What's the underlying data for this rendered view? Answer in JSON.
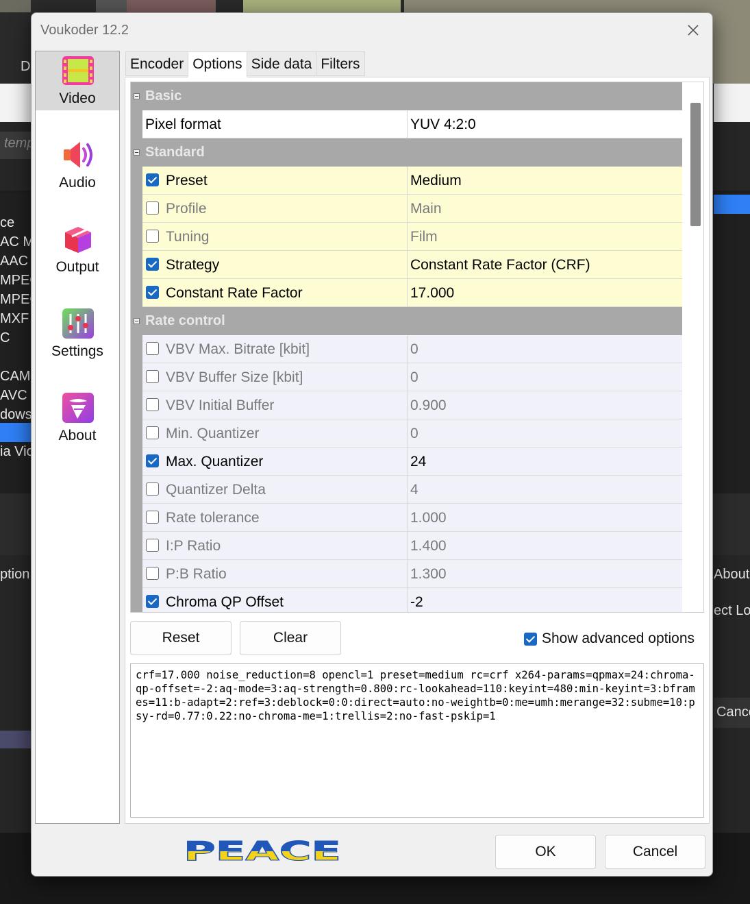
{
  "background": {
    "search_placeholder": "temp",
    "left_letter": "D",
    "list_items": [
      "ce",
      "AC M",
      "AAC",
      "MPEG",
      "MPEG",
      "MXF",
      "C",
      "",
      "CAM",
      "AVC",
      "dows",
      "",
      "ia Vic"
    ],
    "left_options_text": "ption",
    "right_about_text": "About",
    "right_select_text": "ect Lo",
    "right_cancel_text": "Cance"
  },
  "dialog": {
    "title": "Voukoder 12.2",
    "close_glyph": "✕"
  },
  "sidebar": {
    "items": [
      {
        "label": "Video",
        "icon": "film-icon"
      },
      {
        "label": "Audio",
        "icon": "speaker-icon"
      },
      {
        "label": "Output",
        "icon": "box-icon"
      },
      {
        "label": "Settings",
        "icon": "sliders-icon"
      },
      {
        "label": "About",
        "icon": "tornado-icon"
      }
    ]
  },
  "tabs": [
    "Encoder",
    "Options",
    "Side data",
    "Filters"
  ],
  "active_tab": "Options",
  "grid": {
    "categories": {
      "basic": "Basic",
      "standard": "Standard",
      "rate_control": "Rate control"
    },
    "pixel_format": {
      "name": "Pixel format",
      "value": "YUV 4:2:0"
    },
    "standard": [
      {
        "name": "Preset",
        "value": "Medium",
        "checked": true
      },
      {
        "name": "Profile",
        "value": "Main",
        "checked": false
      },
      {
        "name": "Tuning",
        "value": "Film",
        "checked": false
      },
      {
        "name": "Strategy",
        "value": "Constant Rate Factor (CRF)",
        "checked": true
      },
      {
        "name": "Constant Rate Factor",
        "value": "17.000",
        "checked": true
      }
    ],
    "rate_control": [
      {
        "name": "VBV Max. Bitrate [kbit]",
        "value": "0",
        "checked": false
      },
      {
        "name": "VBV Buffer Size [kbit]",
        "value": "0",
        "checked": false
      },
      {
        "name": "VBV Initial Buffer",
        "value": "0.900",
        "checked": false
      },
      {
        "name": "Min. Quantizer",
        "value": "0",
        "checked": false
      },
      {
        "name": "Max. Quantizer",
        "value": "24",
        "checked": true
      },
      {
        "name": "Quantizer Delta",
        "value": "4",
        "checked": false
      },
      {
        "name": "Rate tolerance",
        "value": "1.000",
        "checked": false
      },
      {
        "name": "I:P Ratio",
        "value": "1.400",
        "checked": false
      },
      {
        "name": "P:B Ratio",
        "value": "1.300",
        "checked": false
      },
      {
        "name": "Chroma QP Offset",
        "value": "-2",
        "checked": true
      }
    ]
  },
  "buttons": {
    "reset": "Reset",
    "clear": "Clear",
    "show_advanced": "Show advanced options",
    "show_advanced_checked": true,
    "ok": "OK",
    "cancel": "Cancel"
  },
  "command_line": "crf=17.000 noise_reduction=8 opencl=1 preset=medium rc=crf x264-params=qpmax=24:chroma-qp-offset=-2:aq-mode=3:aq-strength=0.800:rc-lookahead=110:keyint=480:min-keyint=3:bframes=11:b-adapt=2:ref=3:deblock=0:0:direct=auto:no-weightb=0:me=umh:merange=32:subme=10:psy-rd=0.77:0.22:no-chroma-me=1:trellis=2:no-fast-pskip=1",
  "banner_text": "PEACE",
  "colors": {
    "accent": "#1868c4",
    "category_bg": "#a8a8a8",
    "standard_row_bg": "#fdfcd3",
    "rate_row_bg": "#f1f1fa",
    "peace_blue": "#2057b8",
    "peace_yellow": "#f4d21a"
  }
}
